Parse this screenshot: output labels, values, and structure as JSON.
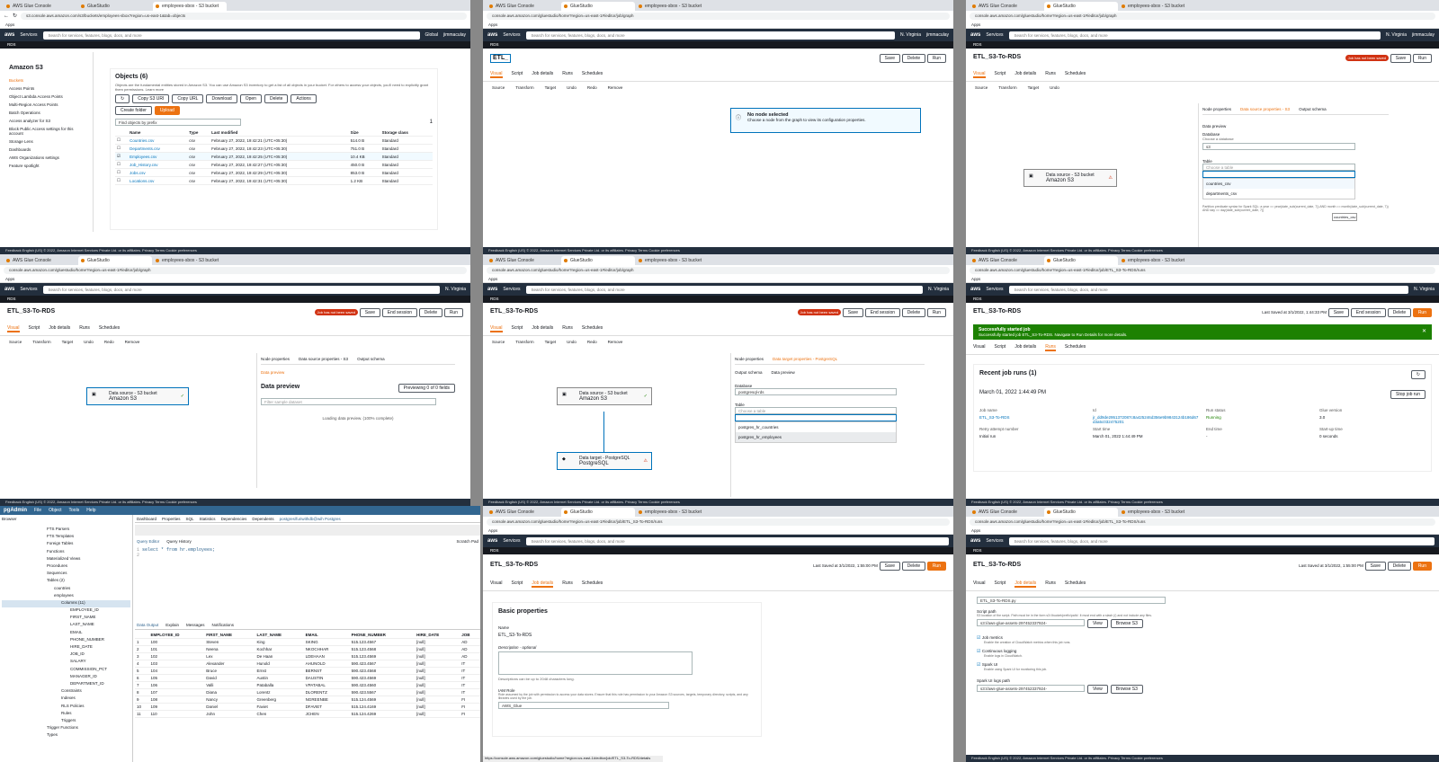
{
  "p1": {
    "tabs": [
      "AWS Glue Console",
      "GlueStudio",
      "employees-sbox - S3 bucket"
    ],
    "url": "s3.console.aws.amazon.com/s3/buckets/employees-sbox?region=us-east-1&tab=objects",
    "apps": "Apps",
    "search": "Search for services, features, blogs, docs, and more",
    "kbd": "[Alt+S]",
    "region": "Global",
    "user": "jimmaculay",
    "sub": "RDS",
    "nav_title": "Amazon S3",
    "nav": [
      "Buckets",
      "Access Points",
      "Object Lambda Access Points",
      "Multi-Region Access Points",
      "Batch Operations",
      "Access analyzer for S3",
      "Block Public Access settings for this account",
      "Storage Lens",
      "Dashboards",
      "AWS Organizations settings",
      "Feature spotlight"
    ],
    "objects_title": "Objects (6)",
    "objects_desc": "Objects are the fundamental entities stored in Amazon S3. You can use Amazon S3 inventory to get a list of all objects in your bucket. For others to access your objects, you'll need to explicitly grant them permissions. Learn more",
    "buttons": [
      "Copy S3 URI",
      "Copy URL",
      "Download",
      "Open",
      "Delete",
      "Actions",
      "Create folder",
      "Upload"
    ],
    "find": "Find objects by prefix",
    "page": "1",
    "cols": [
      "Name",
      "Type",
      "Last modified",
      "Size",
      "Storage class"
    ],
    "rows": [
      [
        "Countries.csv",
        "csv",
        "February 27, 2022, 19:42:21 (UTC+05:30)",
        "514.0 B",
        "Standard"
      ],
      [
        "Departments.csv",
        "csv",
        "February 27, 2022, 19:42:23 (UTC+05:30)",
        "751.0 B",
        "Standard"
      ],
      [
        "Employees.csv",
        "csv",
        "February 27, 2022, 19:42:25 (UTC+05:30)",
        "10.4 KB",
        "Standard"
      ],
      [
        "Job_History.csv",
        "csv",
        "February 27, 2022, 19:42:27 (UTC+05:30)",
        "450.0 B",
        "Standard"
      ],
      [
        "Jobs.csv",
        "csv",
        "February 27, 2022, 19:42:29 (UTC+05:30)",
        "853.0 B",
        "Standard"
      ],
      [
        "Locations.csv",
        "csv",
        "February 27, 2022, 19:42:31 (UTC+05:30)",
        "1.2 KB",
        "Standard"
      ]
    ],
    "foot": "Feedback  English (US)        © 2022, Amazon Internet Services Private Ltd. or its affiliates.   Privacy   Terms   Cookie preferences"
  },
  "p2": {
    "url": "console.aws.amazon.com/gluestudio/home?region=us-east-1#/editor/job/graph",
    "region": "N. Virginia",
    "job": "ETL_",
    "save": "Save",
    "del": "Delete",
    "run": "Run",
    "tabs": [
      "Visual",
      "Script",
      "Job details",
      "Runs",
      "Schedules"
    ],
    "tools": [
      "Source",
      "Transform",
      "Target",
      "Undo",
      "Redo",
      "Remove"
    ],
    "info_title": "No node selected",
    "info_body": "Choose a node from the graph to view its configuration properties."
  },
  "p3": {
    "job": "ETL_S3-To-RDS",
    "notsaved": "Job has not been saved",
    "save": "Save",
    "run": "Run",
    "tabs": [
      "Visual",
      "Script",
      "Job details",
      "Runs",
      "Schedules"
    ],
    "ptabs": [
      "Node properties",
      "Data source properties - S3",
      "Output schema"
    ],
    "dp": "Data preview",
    "db_label": "Database",
    "db_hint": "Choose a database",
    "db": "s3",
    "table": "Table",
    "table_ph": "Choose a table",
    "opts": [
      "countries_csv",
      "departments_csv"
    ],
    "tip": "countries_csv",
    "node_small": "Data source - S3 bucket",
    "node": "Amazon S3",
    "partition": "Partition predicate syntax for Spark SQL: a year == year(date_sub(current_date, 7)) AND month == month(date_sub(current_date, 7)) AND day == day(date_sub(current_date, 7))"
  },
  "p4": {
    "job": "ETL_S3-To-RDS",
    "notsaved": "Job has not been saved",
    "save": "Save",
    "endsession": "End session",
    "del": "Delete",
    "run": "Run",
    "ptabs": [
      "Node properties",
      "Data source properties - S3",
      "Output schema"
    ],
    "dp_tab": "Data preview",
    "dp_title": "Data preview",
    "info": "Info",
    "previewing": "Previewing 0 of 0 fields",
    "filter": "Filter sample dataset",
    "loading": "Loading data preview. (100% complete)",
    "node_small": "Data source - S3 bucket",
    "node": "Amazon S3"
  },
  "p5": {
    "job": "ETL_S3-To-RDS",
    "ptabs": [
      "Node properties",
      "Data target properties - PostgreSQL"
    ],
    "sub": [
      "Output schema",
      "Data preview"
    ],
    "db_label": "Database",
    "db": "postgresql-rds",
    "table": "Table",
    "table_ph": "Choose a table",
    "opts": [
      "postgres_hr_countries",
      "postgres_hr_employees"
    ],
    "node1_small": "Data source - S3 bucket",
    "node1": "Amazon S3",
    "node2_small": "Data target - PostgreSQL",
    "node2": "PostgreSQL"
  },
  "p6": {
    "url": "console.aws.amazon.com/gluestudio/home?region=us-east-1#/editor/job/ETL_S3-To-RDS/runs",
    "job": "ETL_S3-To-RDS",
    "saved": "Last Saved at 3/1/2022, 1:44:33 PM",
    "banner_title": "Successfully started job",
    "banner_body": "Successfully started job ETL_S3-To-RDS. Navigate to Run Details for more details.",
    "runs_title": "Recent job runs (1)",
    "date": "March 01, 2022 1:44:49 PM",
    "stop": "Stop job run",
    "labels": [
      "Job name",
      "Id",
      "Run status",
      "Glue version",
      "Retry attempt number",
      "Start time",
      "End time",
      "Start-up time"
    ],
    "vals": [
      "ETL_S3-To-RDS",
      "jr_dd9de2951372087c8a425246d356e9b9843124b186d67d3a5c032475201",
      "Running",
      "3.0",
      "Initial run",
      "March 01, 2022 1:44:49 PM",
      "-",
      "0 seconds"
    ]
  },
  "p7": {
    "app": "pgAdmin",
    "menus": [
      "File",
      "Object",
      "Tools",
      "Help"
    ],
    "browser": "Browser",
    "tree": [
      "FTS Parsers",
      "FTS Templates",
      "Foreign Tables",
      "Functions",
      "Materialized Views",
      "Procedures",
      "Sequences",
      "Tables (2)",
      "countries",
      "employees",
      "Columns (11)",
      "EMPLOYEE_ID",
      "FIRST_NAME",
      "LAST_NAME",
      "EMAIL",
      "PHONE_NUMBER",
      "HIRE_DATE",
      "JOB_ID",
      "SALARY",
      "COMMISSION_PCT",
      "MANAGER_ID",
      "DEPARTMENT_ID",
      "Constraints",
      "Indexes",
      "RLS Policies",
      "Rules",
      "Triggers",
      "Trigger Functions",
      "Types"
    ],
    "toptabs": [
      "Dashboard",
      "Properties",
      "SQL",
      "Statistics",
      "Dependencies",
      "Dependents",
      "postgres/furiwithdb@wih Postgres"
    ],
    "qtabs": [
      "Query Editor",
      "Query History"
    ],
    "scratch": "Scratch Pad",
    "sql": "select * from hr.employees;",
    "otabs": [
      "Data Output",
      "Explain",
      "Messages",
      "Notifications"
    ],
    "cols": [
      "EMPLOYEE_ID",
      "FIRST_NAME",
      "LAST_NAME",
      "EMAIL",
      "PHONE_NUMBER",
      "HIRE_DATE",
      "JOB"
    ],
    "rows": [
      [
        "100",
        "Steven",
        "King",
        "SKING",
        "515.123.4567",
        "[null]",
        "AD"
      ],
      [
        "101",
        "Neena",
        "Kochhar",
        "NKOCHHAR",
        "515.123.4568",
        "[null]",
        "AD"
      ],
      [
        "102",
        "Lex",
        "De Haan",
        "LDEHAAN",
        "515.123.4569",
        "[null]",
        "AD"
      ],
      [
        "103",
        "Alexander",
        "Hunold",
        "AHUNOLD",
        "590.423.4567",
        "[null]",
        "IT"
      ],
      [
        "104",
        "Bruce",
        "Ernst",
        "BERNST",
        "590.423.4568",
        "[null]",
        "IT"
      ],
      [
        "105",
        "David",
        "Austin",
        "DAUSTIN",
        "590.423.4569",
        "[null]",
        "IT"
      ],
      [
        "106",
        "Valli",
        "Pataballa",
        "VPATABAL",
        "590.423.4560",
        "[null]",
        "IT"
      ],
      [
        "107",
        "Diana",
        "Lorentz",
        "DLORENTZ",
        "590.423.5567",
        "[null]",
        "IT"
      ],
      [
        "108",
        "Nancy",
        "Greenberg",
        "NGREENBE",
        "515.124.4569",
        "[null]",
        "FI"
      ],
      [
        "109",
        "Daniel",
        "Faviet",
        "DFAVIET",
        "515.124.4169",
        "[null]",
        "FI"
      ],
      [
        "110",
        "John",
        "Chen",
        "JCHEN",
        "515.124.4269",
        "[null]",
        "FI"
      ]
    ]
  },
  "p8": {
    "job": "ETL_S3-To-RDS",
    "saved": "Last Saved at 3/1/2022, 1:55:00 PM",
    "save": "Save",
    "del": "Delete",
    "run": "Run",
    "title": "Basic properties",
    "name_label": "Name",
    "name": "ETL_S3-To-RDS",
    "desc_label": "Description - optional",
    "desc_hint": "Descriptions can be up to 2048 characters long.",
    "iam": "IAM Role",
    "iam_hint": "Role assumed by the job with permission to access your data stores. Ensure that this role has permission to your Amazon S3 sources, targets, temporary directory, scripts, and any libraries used by the job.",
    "role": "AWS_Glue",
    "status": "https://console.aws.amazon.com/gluestudio/home?region=us-east-1#/editor/job/ETL_S3-To-RDS/details"
  },
  "p9": {
    "job": "ETL_S3-To-RDS",
    "saved": "Last Saved at 3/1/2022, 1:55:00 PM",
    "script": "ETL_S3-To-RDS.py",
    "path_label": "Script path",
    "path_hint": "S3 location of the script. Path must be in the form s3://bucket/prefix/path/. It must end with a slash (/) and not include any files.",
    "path": "s3://aws-glue-assets-297452337924-",
    "view": "View",
    "browse": "Browse S3",
    "checks": [
      "Job metrics",
      "Continuous logging",
      "Spark UI"
    ],
    "check_hints": [
      "Enable the creation of CloudWatch metrics when this job runs.",
      "Enable logs in CloudWatch.",
      "Enable using Spark UI for monitoring this job."
    ],
    "logs_label": "Spark UI logs path"
  }
}
